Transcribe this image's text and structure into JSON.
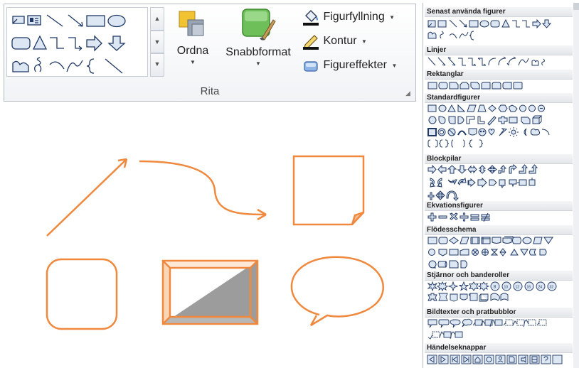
{
  "ribbon": {
    "group_label": "Rita",
    "arrange_label": "Ordna",
    "quick_styles_label": "Snabbformat",
    "shape_fill_label": "Figurfyllning",
    "shape_outline_label": "Kontur",
    "shape_effects_label": "Figureffekter"
  },
  "panel": {
    "categories": [
      "Senast använda figurer",
      "Linjer",
      "Rektanglar",
      "Standardfigurer",
      "Blockpilar",
      "Ekvationsfigurer",
      "Flödesschema",
      "Stjärnor och banderoller",
      "Bildtexter och pratbubblor",
      "Händelseknappar"
    ]
  },
  "colors": {
    "shape_outline": "#f0883e",
    "icon_stroke": "#1f3864",
    "icon_fill": "#dde6f3"
  }
}
